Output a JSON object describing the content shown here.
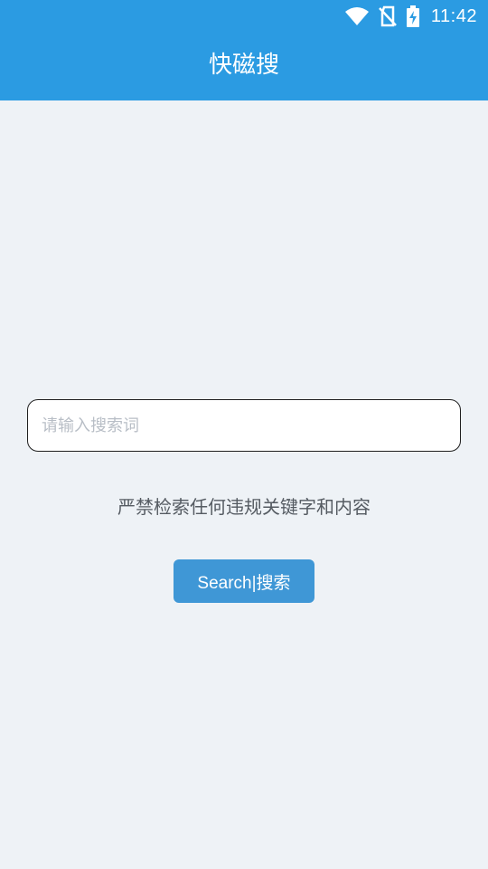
{
  "status_bar": {
    "time": "11:42",
    "icons": [
      "wifi-icon",
      "no-sim-icon",
      "battery-charging-icon"
    ]
  },
  "header": {
    "title": "快磁搜"
  },
  "search": {
    "value": "",
    "placeholder": "请输入搜索词",
    "notice": "严禁检索任何违规关键字和内容",
    "button_label": "Search|搜索"
  },
  "colors": {
    "header_bg": "#2b9be2",
    "page_bg": "#eef2f6",
    "button_bg": "#3f97d6",
    "notice_text": "#555b62"
  }
}
